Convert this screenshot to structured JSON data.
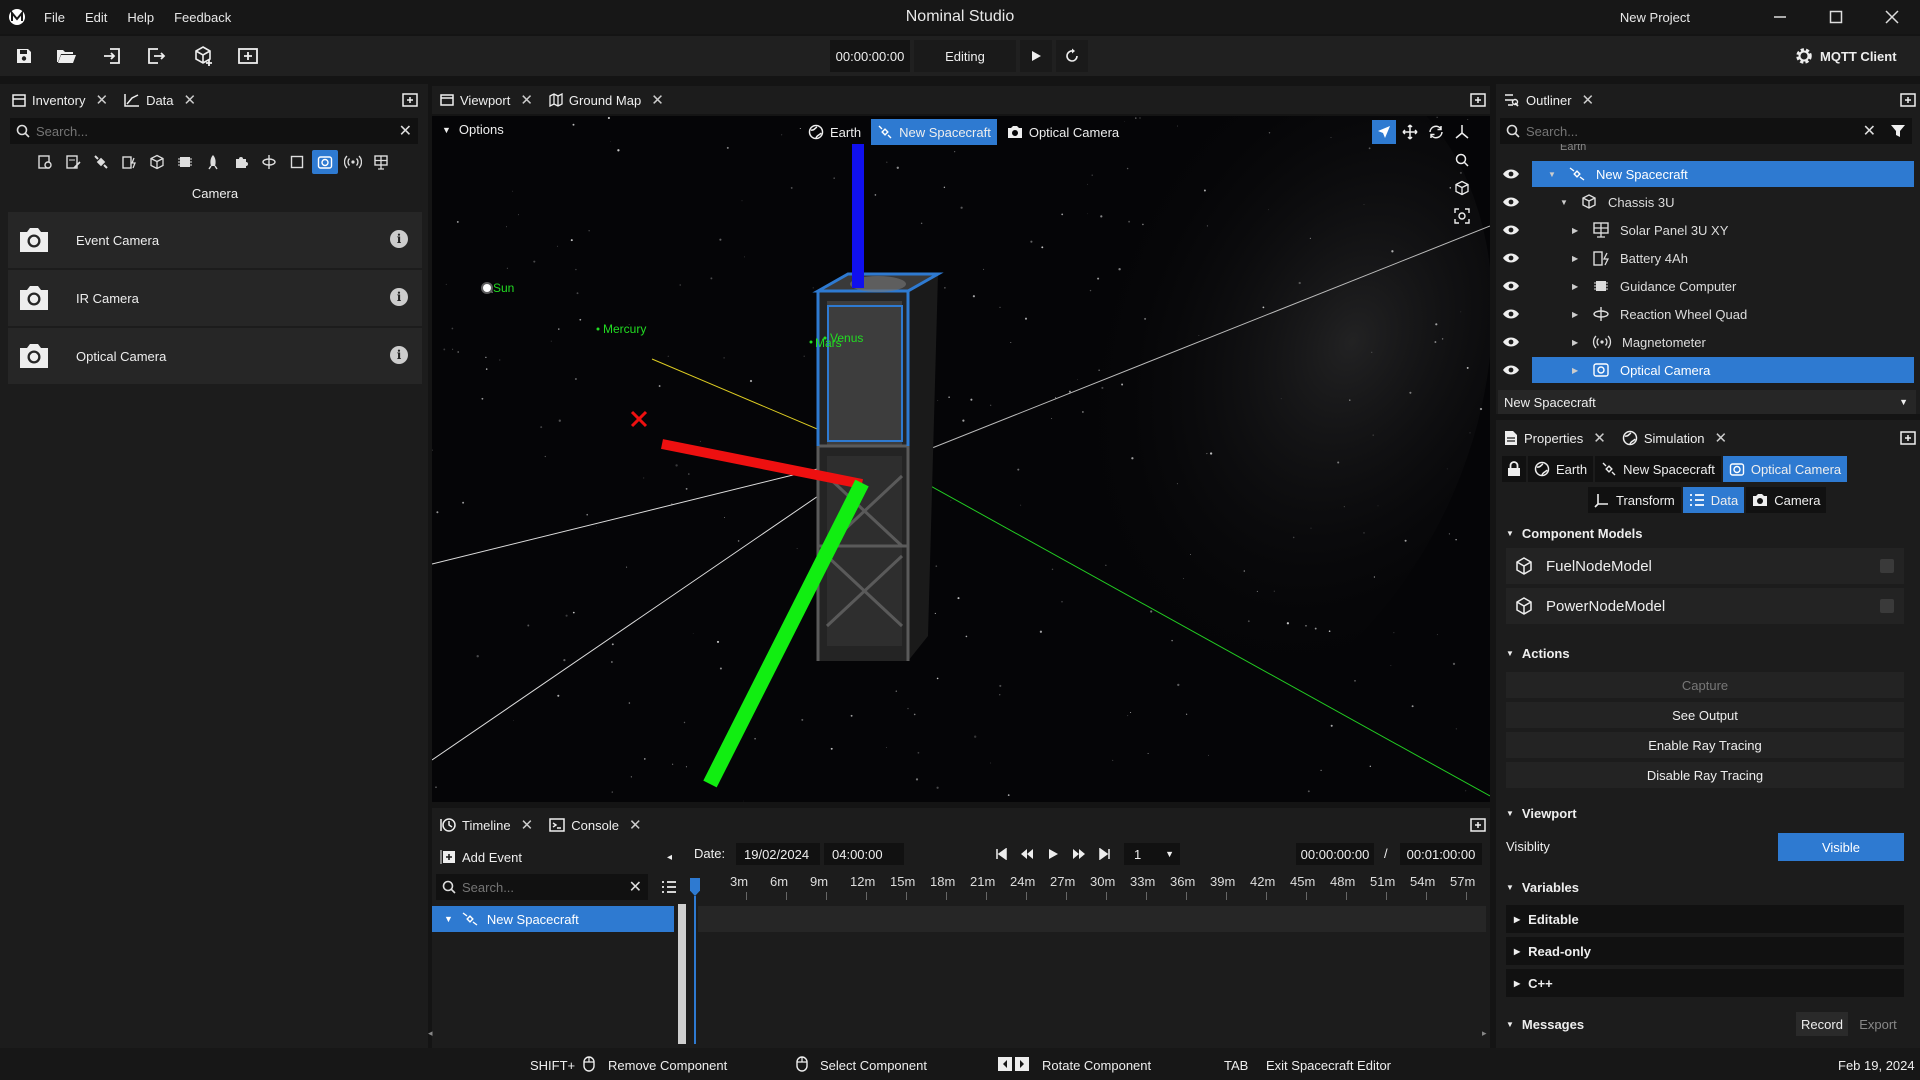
{
  "app": {
    "title": "Nominal Studio",
    "project": "New Project"
  },
  "menu": [
    "File",
    "Edit",
    "Help",
    "Feedback"
  ],
  "toolbar": {
    "time": "00:00:00:00",
    "mode": "Editing",
    "mqtt_label": "MQTT Client"
  },
  "left_panel": {
    "tabs": [
      {
        "label": "Inventory",
        "icon": "inventory-icon"
      },
      {
        "label": "Data",
        "icon": "chart-line-icon"
      }
    ],
    "search_placeholder": "Search...",
    "category": "Camera",
    "items": [
      {
        "label": "Event Camera",
        "icon": "camera-icon"
      },
      {
        "label": "IR Camera",
        "icon": "camera-icon"
      },
      {
        "label": "Optical Camera",
        "icon": "camera-icon"
      }
    ]
  },
  "viewport": {
    "tabs": [
      {
        "label": "Viewport",
        "icon": "window-icon"
      },
      {
        "label": "Ground Map",
        "icon": "map-icon"
      }
    ],
    "options_label": "Options",
    "breadcrumbs": [
      {
        "label": "Earth",
        "icon": "globe-icon",
        "selected": false
      },
      {
        "label": "New Spacecraft",
        "icon": "satellite-icon",
        "selected": true
      },
      {
        "label": "Optical Camera",
        "icon": "camera-icon",
        "selected": false
      }
    ],
    "celestial_labels": {
      "sun": "Sun",
      "mercury": "Mercury",
      "mars": "Mars",
      "venus": "Venus"
    }
  },
  "outliner": {
    "tab": "Outliner",
    "search_placeholder": "Search...",
    "partial_top": "Earth",
    "items": [
      {
        "label": "New Spacecraft",
        "icon": "satellite-icon",
        "depth": 0,
        "expanded": true,
        "selected": true
      },
      {
        "label": "Chassis 3U",
        "icon": "cube-icon",
        "depth": 1,
        "expanded": true,
        "selected": false
      },
      {
        "label": "Solar Panel 3U XY",
        "icon": "solar-panel-icon",
        "depth": 2,
        "expanded": false,
        "selected": false
      },
      {
        "label": "Battery 4Ah",
        "icon": "battery-icon",
        "depth": 2,
        "expanded": false,
        "selected": false
      },
      {
        "label": "Guidance Computer",
        "icon": "chip-icon",
        "depth": 2,
        "expanded": false,
        "selected": false
      },
      {
        "label": "Reaction Wheel Quad",
        "icon": "reaction-wheel-icon",
        "depth": 2,
        "expanded": false,
        "selected": false
      },
      {
        "label": "Magnetometer",
        "icon": "antenna-icon",
        "depth": 2,
        "expanded": false,
        "selected": false
      },
      {
        "label": "Optical Camera",
        "icon": "camera-icon",
        "depth": 2,
        "expanded": false,
        "selected": true
      }
    ],
    "dropdown": "New Spacecraft"
  },
  "properties": {
    "tabs": [
      {
        "label": "Properties",
        "icon": "document-icon"
      },
      {
        "label": "Simulation",
        "icon": "globe-icon"
      }
    ],
    "path": [
      {
        "label": "Earth",
        "icon": "globe-icon",
        "selected": false
      },
      {
        "label": "New Spacecraft",
        "icon": "satellite-icon",
        "selected": false
      },
      {
        "label": "Optical Camera",
        "icon": "camera-icon",
        "selected": true
      }
    ],
    "subtabs": [
      {
        "label": "Transform",
        "icon": "axes-icon",
        "selected": false
      },
      {
        "label": "Data",
        "icon": "list-icon",
        "selected": true
      },
      {
        "label": "Camera",
        "icon": "camera-icon",
        "selected": false
      }
    ],
    "component_models_title": "Component Models",
    "models": [
      "FuelNodeModel",
      "PowerNodeModel"
    ],
    "actions_title": "Actions",
    "actions": [
      {
        "label": "Capture",
        "enabled": false
      },
      {
        "label": "See Output",
        "enabled": true
      },
      {
        "label": "Enable Ray Tracing",
        "enabled": true
      },
      {
        "label": "Disable Ray Tracing",
        "enabled": true
      }
    ],
    "viewport_title": "Viewport",
    "visibility_label": "Visiblity",
    "visibility_value": "Visible",
    "variables_title": "Variables",
    "variables": [
      "Editable",
      "Read-only",
      "C++"
    ],
    "messages_title": "Messages",
    "record_label": "Record",
    "export_label": "Export"
  },
  "timeline": {
    "tabs": [
      {
        "label": "Timeline",
        "icon": "timeline-icon"
      },
      {
        "label": "Console",
        "icon": "console-icon"
      }
    ],
    "add_event": "Add Event",
    "search_placeholder": "Search...",
    "date_label": "Date:",
    "date": "19/02/2024",
    "time": "04:00:00",
    "speed": "1",
    "current": "00:00:00:00",
    "separator": "/",
    "duration": "00:01:00:00",
    "ticks": [
      "3m",
      "6m",
      "9m",
      "12m",
      "15m",
      "18m",
      "21m",
      "24m",
      "27m",
      "30m",
      "33m",
      "36m",
      "39m",
      "42m",
      "45m",
      "48m",
      "51m",
      "54m",
      "57m"
    ],
    "tracks": [
      "New Spacecraft"
    ]
  },
  "statusbar": {
    "shift": "SHIFT+",
    "remove": "Remove Component",
    "select": "Select Component",
    "rotate": "Rotate Component",
    "tab": "TAB",
    "exit": "Exit Spacecraft Editor",
    "date": "Feb 19, 2024"
  },
  "colors": {
    "accent": "#2e7ad1",
    "background": "#141414",
    "panel": "#1c1c1c",
    "x_axis": "#ff1a1a",
    "y_axis": "#1aff1a",
    "z_axis": "#1010ff",
    "planet_label": "#22dd22"
  }
}
